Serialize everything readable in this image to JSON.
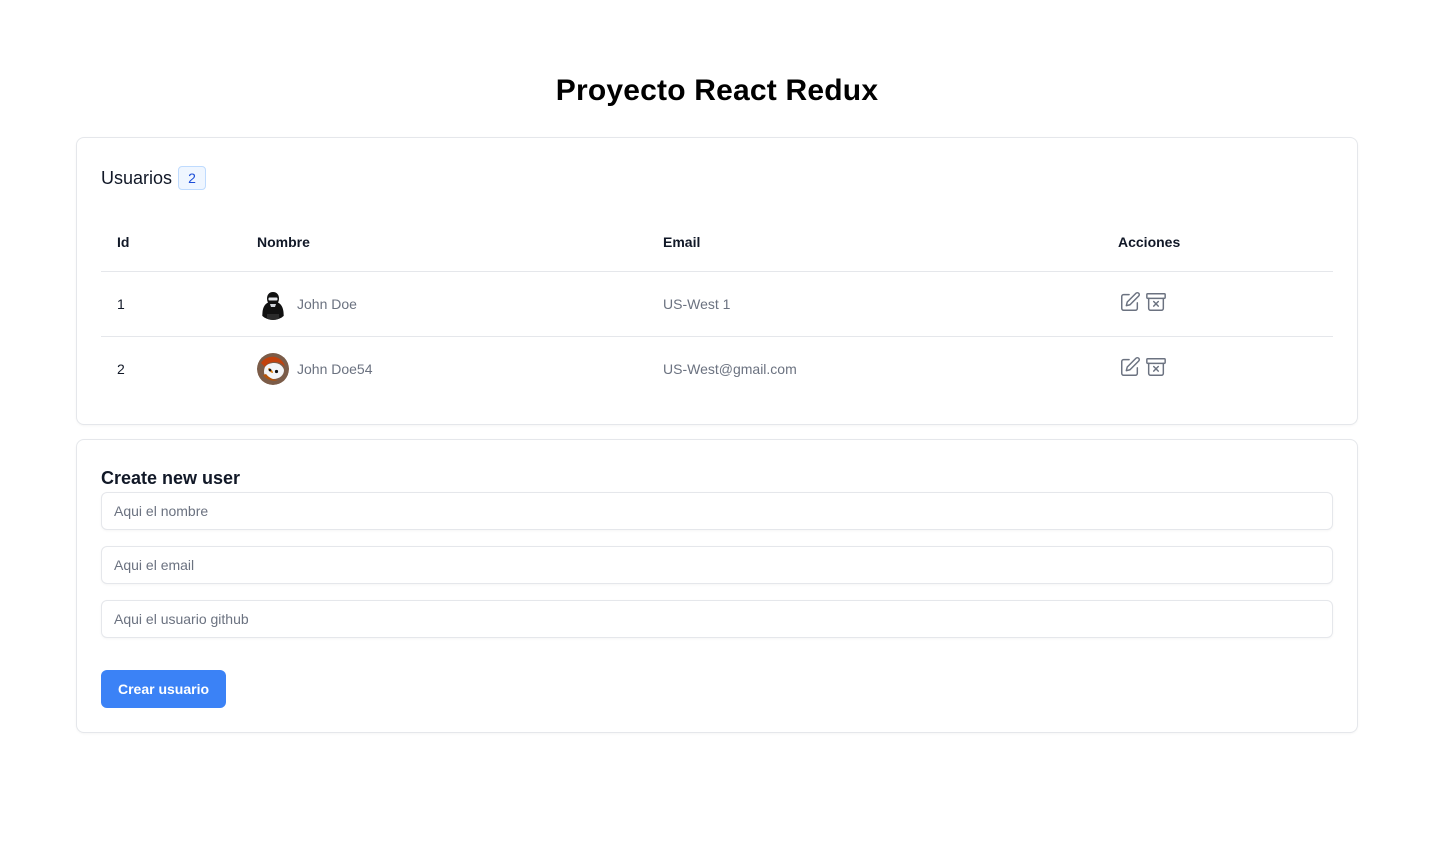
{
  "page": {
    "title": "Proyecto React Redux"
  },
  "users": {
    "heading": "Usuarios",
    "count": "2",
    "columns": [
      "Id",
      "Nombre",
      "Email",
      "Acciones"
    ],
    "rows": [
      {
        "id": "1",
        "name": "John Doe",
        "email": "US-West 1",
        "avatar_icon": "hooded-figure-avatar"
      },
      {
        "id": "2",
        "name": "John Doe54",
        "email": "US-West@gmail.com",
        "avatar_icon": "red-panda-avatar"
      }
    ],
    "action_icons": [
      "edit-icon",
      "archive-delete-icon"
    ],
    "icon_color": "#6b7280"
  },
  "create_form": {
    "title": "Create new user",
    "name_placeholder": "Aqui el nombre",
    "email_placeholder": "Aqui el email",
    "github_placeholder": "Aqui el usuario github",
    "submit_label": "Crear usuario"
  },
  "colors": {
    "accent": "#3b82f6",
    "badge_bg": "#eff6ff",
    "badge_text": "#1d4ed8",
    "border": "#e5e7eb"
  }
}
